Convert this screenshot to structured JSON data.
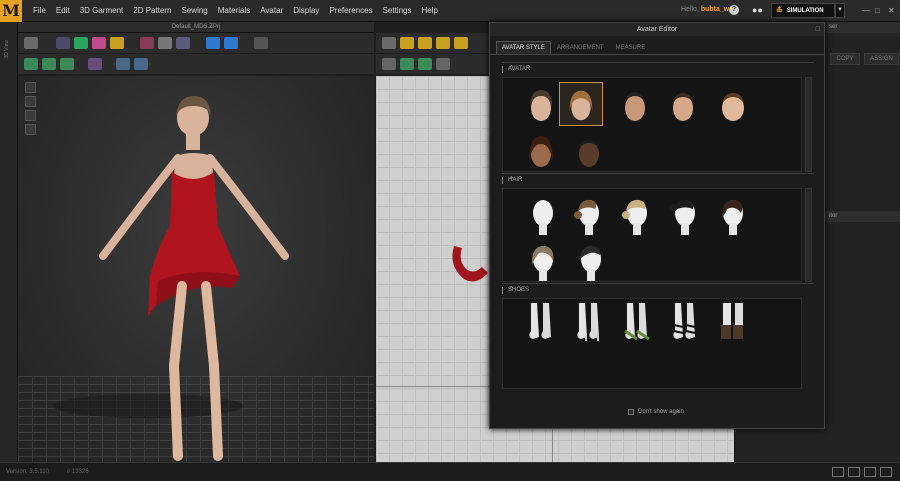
{
  "app": {
    "logo_letter": "M",
    "accent": "#e8a020"
  },
  "menu": [
    "File",
    "Edit",
    "3D Garment",
    "2D Pattern",
    "Sewing",
    "Materials",
    "Avatar",
    "Display",
    "Preferences",
    "Settings",
    "Help"
  ],
  "header": {
    "hello": "Hello,",
    "username": "bubta_ws",
    "simulation_label": "SIMULATION"
  },
  "panel3d": {
    "title": "Default_MDS.ZPrj"
  },
  "left_strip_label": "3D View",
  "right_panel": {
    "head1": "ser",
    "copy": "COPY",
    "assign": "ASSIGN",
    "head2": "itor"
  },
  "dialog": {
    "title": "Avatar Editor",
    "tabs": [
      {
        "label": "AVATAR STYLE",
        "active": true
      },
      {
        "label": "ARRANGEMENT",
        "active": false
      },
      {
        "label": "MEASURE",
        "active": false
      }
    ],
    "sections": {
      "avatar": "AVATAR",
      "hair": "HAIR",
      "shoes": "SHOES"
    },
    "dont_show": "Don't show again"
  },
  "status": {
    "version": "Version: 3.5.110",
    "build": "# 13326"
  }
}
